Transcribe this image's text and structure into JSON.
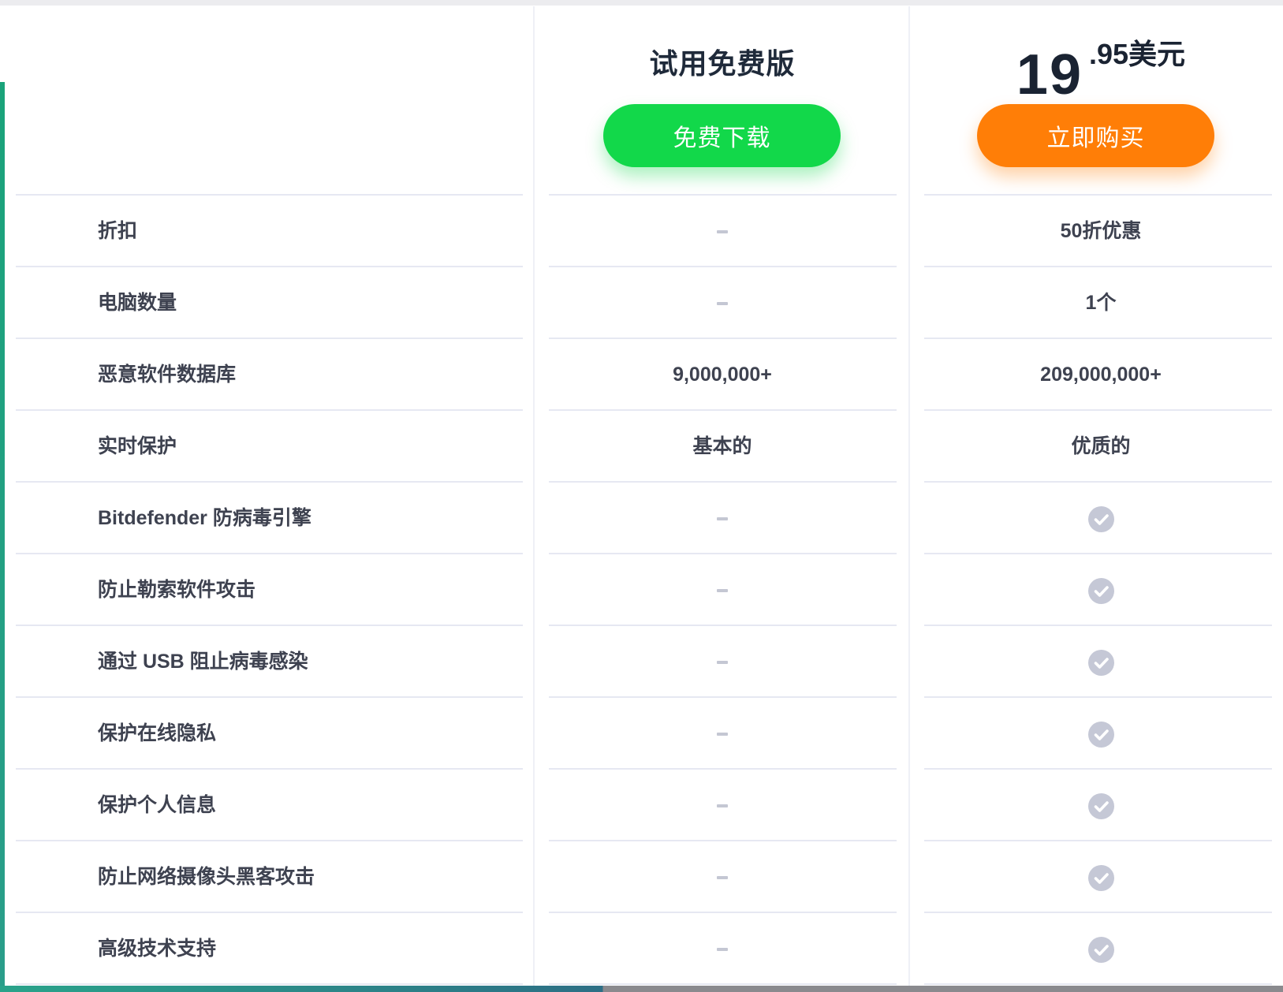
{
  "header": {
    "free_title": "试用免费版",
    "price_integer": "19",
    "price_decimal": ".95美元",
    "free_button_label": "免费下载",
    "buy_button_label": "立即购买"
  },
  "colors": {
    "free_button": "#12d84a",
    "buy_button": "#ff7e07",
    "text": "#3e4250",
    "check": "#c5c8d6"
  },
  "rows": [
    {
      "label": "折扣",
      "free": "–",
      "paid": "50折优惠"
    },
    {
      "label": "电脑数量",
      "free": "–",
      "paid": "1个"
    },
    {
      "label": "恶意软件数据库",
      "free": "9,000,000+",
      "paid": "209,000,000+"
    },
    {
      "label": "实时保护",
      "free": "基本的",
      "paid": "优质的"
    },
    {
      "label": "Bitdefender 防病毒引擎",
      "free": "–",
      "paid": "check-icon"
    },
    {
      "label": "防止勒索软件攻击",
      "free": "–",
      "paid": "check-icon"
    },
    {
      "label": "通过 USB 阻止病毒感染",
      "free": "–",
      "paid": "check-icon"
    },
    {
      "label": "保护在线隐私",
      "free": "–",
      "paid": "check-icon"
    },
    {
      "label": "保护个人信息",
      "free": "–",
      "paid": "check-icon"
    },
    {
      "label": "防止网络摄像头黑客攻击",
      "free": "–",
      "paid": "check-icon"
    },
    {
      "label": "高级技术支持",
      "free": "–",
      "paid": "check-icon"
    }
  ]
}
